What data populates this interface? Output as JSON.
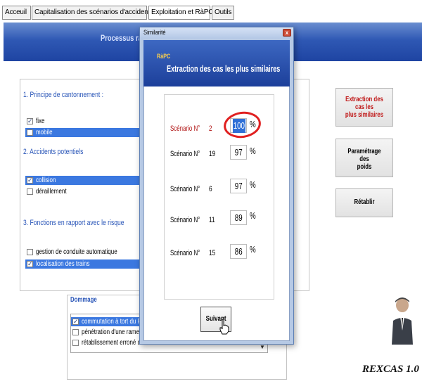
{
  "tabs": [
    {
      "label": "Acceuil"
    },
    {
      "label": "Capitalisation des scénarios d'accidents"
    },
    {
      "label": "Exploitation et RàPC"
    },
    {
      "label": "Outils"
    }
  ],
  "banner": {
    "title": "Processus ra"
  },
  "sections": {
    "confinement": {
      "title": "1. Principe de cantonnement :",
      "items": [
        {
          "label": "fixe",
          "checked": true
        },
        {
          "label": "mobile",
          "checked": false
        }
      ]
    },
    "accidents": {
      "title": "2. Accidents potentiels",
      "items": [
        {
          "label": "collision",
          "checked": true
        },
        {
          "label": "déraillement",
          "checked": false
        }
      ]
    },
    "fonctions": {
      "title": "3. Fonctions en rapport avec le risque",
      "items": [
        {
          "label": "gestion de conduite automatique",
          "checked": false
        },
        {
          "label": "localisation des trains",
          "checked": true
        }
      ]
    }
  },
  "right_buttons": {
    "extraction": [
      "Extraction des cas les",
      "plus similaires"
    ],
    "parametrage": [
      "Paramétrage des",
      "poids"
    ],
    "retablir": "Rétablir"
  },
  "dommage": {
    "title": "Dommage",
    "items": [
      {
        "label": "commutation à tort du PA",
        "checked": true
      },
      {
        "label": "pénétration d'une rame su",
        "checked": false
      },
      {
        "label": "rétablissement erroné de PA/NT",
        "checked": false
      }
    ]
  },
  "app_name": "REXCAS 1.0",
  "dialog": {
    "window_title": "Similarité",
    "close_glyph": "x",
    "badge": "RàPC",
    "heading": "Extraction des cas les plus similaires",
    "scenario_prefix": "Scénario N°",
    "percent_sign": "%",
    "results": [
      {
        "scenario": "2",
        "similarity": "100"
      },
      {
        "scenario": "19",
        "similarity": "97"
      },
      {
        "scenario": "6",
        "similarity": "97"
      },
      {
        "scenario": "11",
        "similarity": "89"
      },
      {
        "scenario": "15",
        "similarity": "86"
      }
    ],
    "next_button": "Suivant"
  },
  "colors": {
    "banner": "#2f58b4",
    "section_title": "#2a56b8",
    "highlight": "#3b78e0",
    "annotation_ring": "#e02020",
    "top_result": "#b01414"
  }
}
